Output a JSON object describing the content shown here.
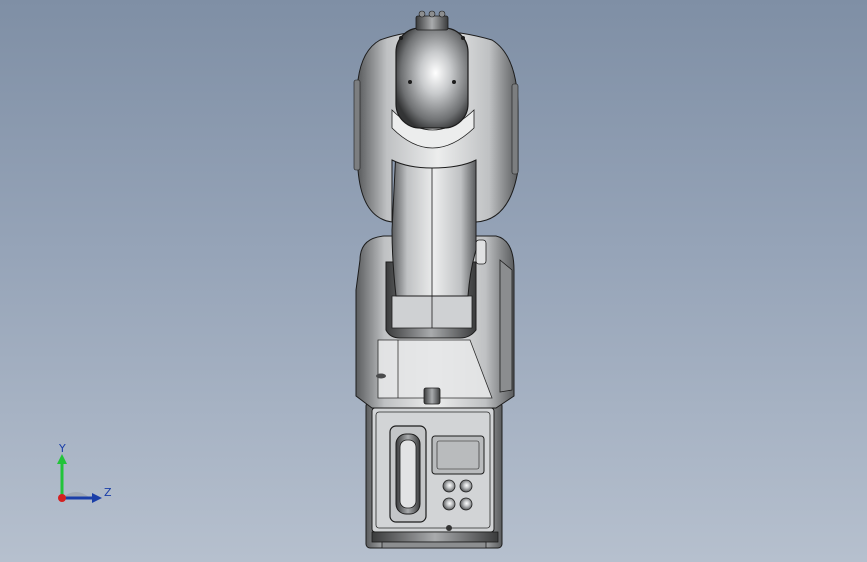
{
  "viewport": {
    "background_top": "#7f8fa5",
    "background_bottom": "#b6c0ce",
    "part_color": "#d8dadc",
    "edge_color": "#1c1c1c"
  },
  "triad": {
    "y_label": "Y",
    "z_label": "Z",
    "y_color": "#22c43a",
    "z_color": "#1a3ea8",
    "x_color": "#d42020"
  }
}
